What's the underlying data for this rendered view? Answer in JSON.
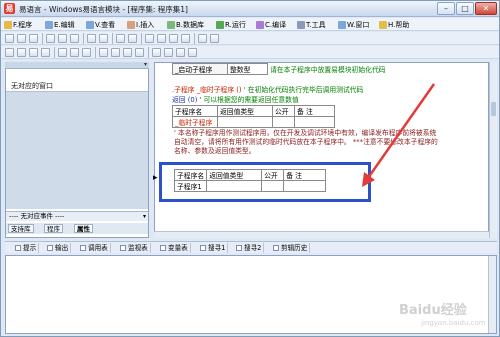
{
  "window": {
    "title": "易语言 - Windows易语言模块 - [程序集: 程序集1]",
    "app_icon": "易",
    "minimize": "–",
    "maximize": "□",
    "close": "✕"
  },
  "menu": [
    {
      "label": "F.程序",
      "icon": "file-icon",
      "color": "#e8b84a"
    },
    {
      "label": "E.编辑",
      "icon": "edit-icon",
      "color": "#7ca7d8"
    },
    {
      "label": "V.查看",
      "icon": "view-icon",
      "color": "#7ca7d8"
    },
    {
      "label": "I.插入",
      "icon": "insert-icon",
      "color": "#d8a07c"
    },
    {
      "label": "B.数据库",
      "icon": "database-icon",
      "color": "#7cb87c"
    },
    {
      "label": "R.运行",
      "icon": "run-icon",
      "color": "#58a858"
    },
    {
      "label": "C.编译",
      "icon": "compile-icon",
      "color": "#a87cd8"
    },
    {
      "label": "T.工具",
      "icon": "tools-icon",
      "color": "#8a9ab8"
    },
    {
      "label": "W.窗口",
      "icon": "window-icon",
      "color": "#7ca7d8"
    },
    {
      "label": "H.帮助",
      "icon": "help-icon",
      "color": "#e0c04a"
    }
  ],
  "left_panel": {
    "no_window": "无对应的窗口",
    "event_bar": "---- 无对应事件 ----",
    "tabs": [
      "支持库",
      "程序",
      "属性"
    ]
  },
  "editor": {
    "init_table": {
      "name": "_启动子程序",
      "type": "整数型",
      "comment": "请在本子程序中放置易模块初始化代码"
    },
    "sub_decl": {
      "keyword": ".子程序",
      "name": "_临时子程序 ()",
      "comment": "' 在初始化代码执行完毕后调用测试代码"
    },
    "return_line": {
      "keyword": "返回 (0)",
      "comment": "' 可以根据您的需要返回任意数值"
    },
    "temp_table": {
      "headers": [
        "子程序名",
        "返回值类型",
        "公开",
        "备 注"
      ],
      "row": [
        "_临时子程序",
        "",
        "",
        ""
      ]
    },
    "comment_lines": [
      "' 本名称子程序用作测试程序用，仅在开发及调试环境中有效，编译发布程序前将被系统",
      "自动清空，请将所有用作测试的临时代码放在本子程序中。 ***注意不要修改本子程序的",
      "名称、参数及返回值类型。"
    ],
    "new_table": {
      "headers": [
        "子程序名",
        "返回值类型",
        "公开",
        "备 注"
      ],
      "row": [
        "子程序1",
        "",
        "",
        ""
      ]
    }
  },
  "output_tabs": [
    {
      "label": "提示",
      "icon": "hint-icon"
    },
    {
      "label": "输出",
      "icon": "output-icon"
    },
    {
      "label": "调用表",
      "icon": "call-table-icon"
    },
    {
      "label": "监视表",
      "icon": "watch-icon"
    },
    {
      "label": "变量表",
      "icon": "variable-icon"
    },
    {
      "label": "搜寻1",
      "icon": "search1-icon"
    },
    {
      "label": "搜寻2",
      "icon": "search2-icon"
    },
    {
      "label": "剪辑历史",
      "icon": "clip-history-icon"
    }
  ],
  "watermark": {
    "main": "Baidu经验",
    "sub": "jingyan.baidu.com"
  },
  "colors": {
    "highlight_box": "#2d51c8",
    "arrow": "#e33a3a"
  }
}
